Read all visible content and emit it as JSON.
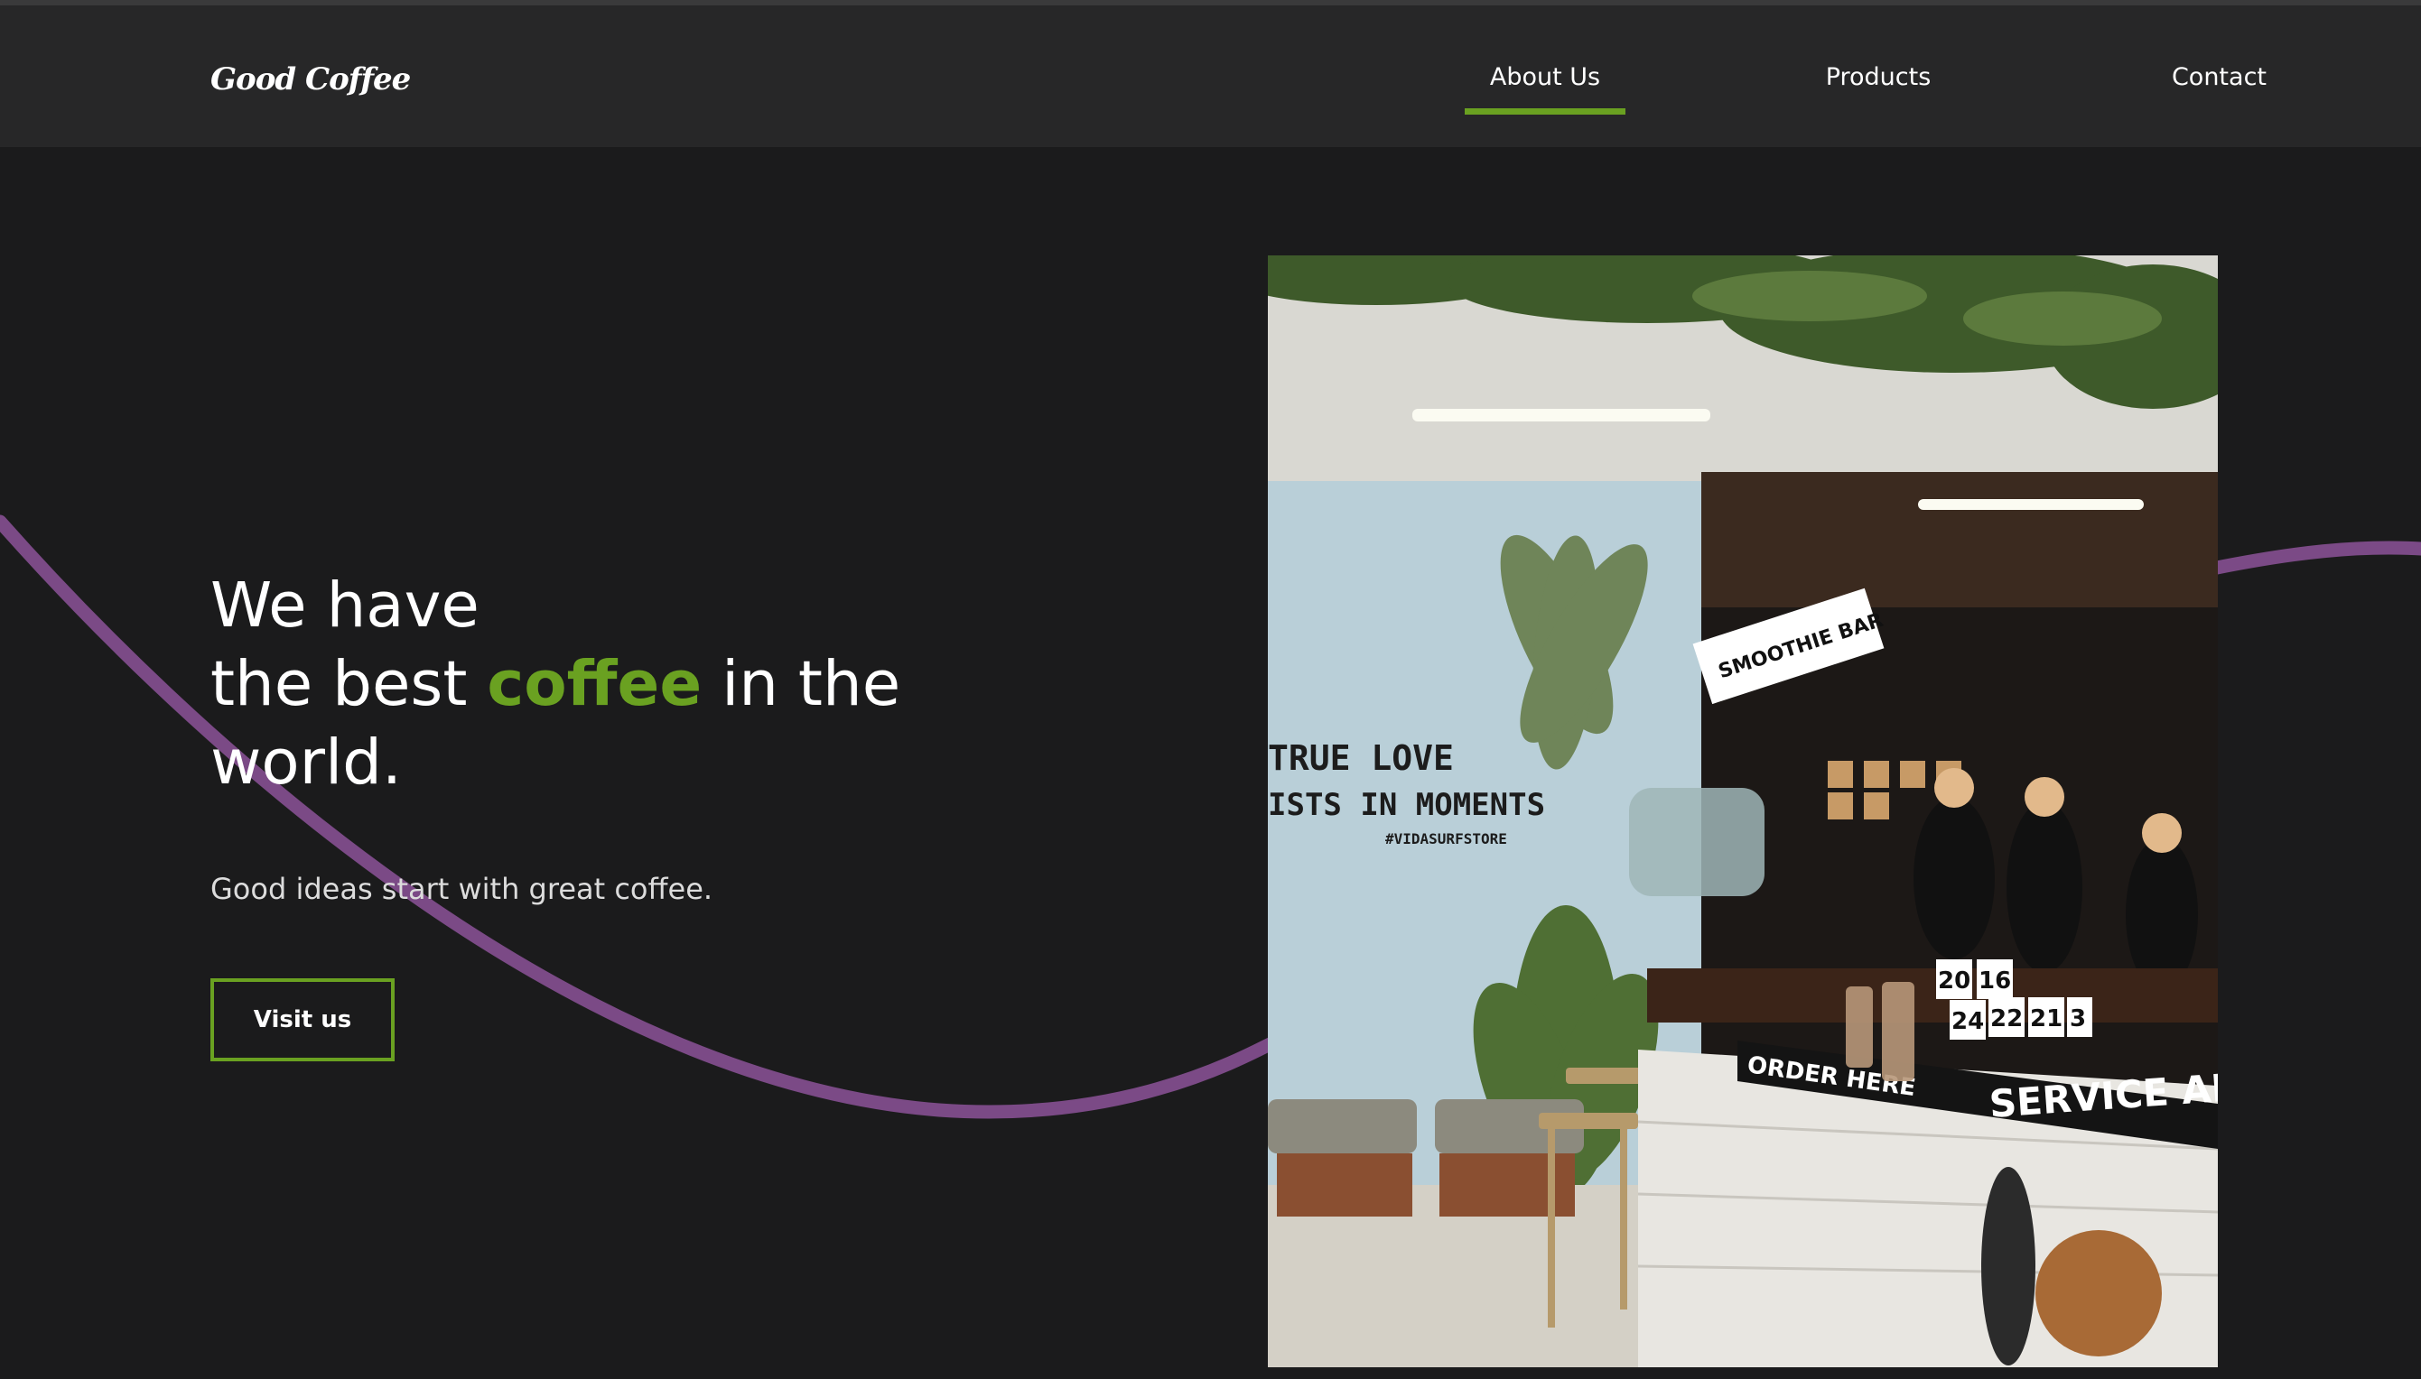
{
  "brand": {
    "logo": "Good Coffee"
  },
  "nav": {
    "items": [
      {
        "label": "About Us",
        "active": true
      },
      {
        "label": "Products",
        "active": false
      },
      {
        "label": "Contact",
        "active": false
      }
    ]
  },
  "hero": {
    "title_line1": "We have",
    "title_pre": "the best ",
    "title_accent": "coffee",
    "title_post": " in the",
    "title_line3": "world.",
    "subtitle": "Good ideas start with great coffee.",
    "cta_label": "Visit us"
  },
  "photo": {
    "wall_line1": "TRUE LOVE",
    "wall_line2": "ISTS IN MOMENTS",
    "wall_tag": "#VIDASURFSTORE",
    "sign_bar": "SMOOTHIE BAR",
    "counter_order": "ORDER HERE",
    "counter_service": "SERVICE AR",
    "numbers": [
      "20",
      "16",
      "24",
      "22",
      "21",
      "3"
    ]
  },
  "colors": {
    "accent": "#6aa121",
    "curve": "#7b4a86",
    "background": "#1b1b1c",
    "header": "#272728"
  }
}
